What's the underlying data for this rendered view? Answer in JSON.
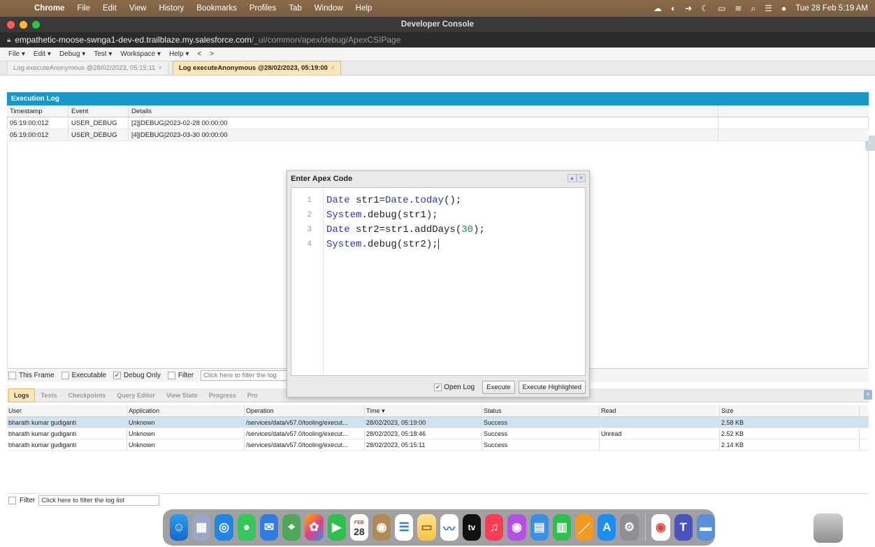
{
  "menubar": {
    "app": "Chrome",
    "items": [
      "File",
      "Edit",
      "View",
      "History",
      "Bookmarks",
      "Profiles",
      "Tab",
      "Window",
      "Help"
    ],
    "clock": "Tue 28 Feb  5:19 AM"
  },
  "window": {
    "title": "Developer Console",
    "url_host": "empathetic-moose-swnga1-dev-ed.trailblaze.my.salesforce.com",
    "url_path": "/_ui/common/apex/debug/ApexCSIPage"
  },
  "console_menu": [
    "File ▾",
    "Edit ▾",
    "Debug ▾",
    "Test ▾",
    "Workspace ▾",
    "Help ▾",
    "<",
    ">"
  ],
  "tabs": [
    {
      "label": "Log executeAnonymous @28/02/2023, 05:15:11"
    },
    {
      "label": "Log executeAnonymous @28/02/2023, 05:19:00"
    }
  ],
  "execution_log": {
    "title": "Execution Log",
    "columns": [
      "Timestamp",
      "Event",
      "Details"
    ],
    "rows": [
      {
        "timestamp": "05:19:00:012",
        "event": "USER_DEBUG",
        "details": "[2]|DEBUG|2023-02-28 00:00:00"
      },
      {
        "timestamp": "05:19:00:012",
        "event": "USER_DEBUG",
        "details": "[4]|DEBUG|2023-03-30 00:00:00"
      }
    ]
  },
  "filters": {
    "this_frame": "This Frame",
    "executable": "Executable",
    "debug_only": "Debug Only",
    "filter": "Filter",
    "placeholder": "Click here to filter the log"
  },
  "bottom_tabs": [
    "Logs",
    "Tests",
    "Checkpoints",
    "Query Editor",
    "View State",
    "Progress",
    "Pro"
  ],
  "logs": {
    "columns": [
      "User",
      "Application",
      "Operation",
      "Time ▾",
      "Status",
      "Read",
      "Size"
    ],
    "rows": [
      {
        "user": "bharath kumar gudiganti",
        "application": "Unknown",
        "operation": "/services/data/v57.0/tooling/execut...",
        "time": "28/02/2023, 05:19:00",
        "status": "Success",
        "read": "",
        "size": "2.58 KB"
      },
      {
        "user": "bharath kumar gudiganti",
        "application": "Unknown",
        "operation": "/services/data/v57.0/tooling/execut...",
        "time": "28/02/2023, 05:18:46",
        "status": "Success",
        "read": "Unread",
        "size": "2.52 KB"
      },
      {
        "user": "bharath kumar gudiganti",
        "application": "Unknown",
        "operation": "/services/data/v57.0/tooling/execut...",
        "time": "28/02/2023, 05:15:11",
        "status": "Success",
        "read": "",
        "size": "2.14 KB"
      }
    ]
  },
  "bottom_filter": {
    "label": "Filter",
    "value": "Click here to filter the log list"
  },
  "apex_dialog": {
    "title": "Enter Apex Code",
    "line_numbers": [
      "1",
      "2",
      "3",
      "4"
    ],
    "open_log": "Open Log",
    "execute": "Execute",
    "execute_highlighted": "Execute Highlighted"
  },
  "dock": {
    "calendar_month": "FEB",
    "calendar_day": "28",
    "tv_label": "tv"
  }
}
